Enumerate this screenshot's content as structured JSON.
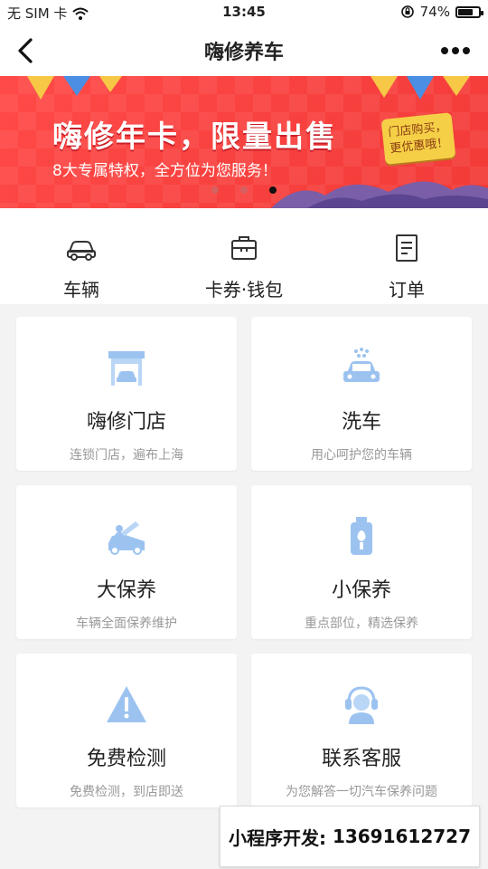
{
  "status_bar": {
    "carrier": "无 SIM 卡",
    "time": "13:45",
    "battery": "74%",
    "battery_level": 0.74
  },
  "nav": {
    "title": "嗨修养车"
  },
  "banner": {
    "headline": "嗨修年卡，限量出售",
    "subtitle": "8大专属特权，全方位为您服务！",
    "tag_line1": "门店购买，",
    "tag_line2": "更优惠哦！",
    "slides": 3,
    "active_slide": 3
  },
  "quick_menu": [
    {
      "icon": "car-icon",
      "label": "车辆"
    },
    {
      "icon": "wallet-icon",
      "label": "卡券·钱包"
    },
    {
      "icon": "order-icon",
      "label": "订单"
    }
  ],
  "services": [
    {
      "icon": "store-icon",
      "title": "嗨修门店",
      "desc": "连锁门店，遍布上海"
    },
    {
      "icon": "car-wash-icon",
      "title": "洗车",
      "desc": "用心呵护您的车辆"
    },
    {
      "icon": "hood-open-icon",
      "title": "大保养",
      "desc": "车辆全面保养维护"
    },
    {
      "icon": "oil-bottle-icon",
      "title": "小保养",
      "desc": "重点部位，精选保养"
    },
    {
      "icon": "warning-icon",
      "title": "免费检测",
      "desc": "免费检测，到店即送"
    },
    {
      "icon": "headset-icon",
      "title": "联系客服",
      "desc": "为您解答一切汽车保养问题"
    }
  ],
  "watermark": {
    "label": "小程序开发:",
    "phone": "13691612727"
  },
  "colors": {
    "accent_icon": "#9cc3f0",
    "banner_red": "#f23a37"
  }
}
